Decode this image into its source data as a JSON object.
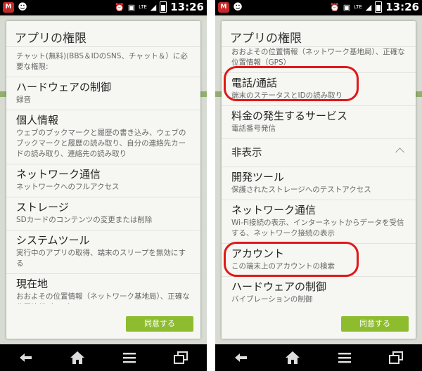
{
  "colors": {
    "accent_green": "#8ebc2f",
    "highlight_red": "#e01818"
  },
  "status_bar": {
    "time": "13:26",
    "network": "LTE"
  },
  "left_screen": {
    "title": "アプリの権限",
    "intro": "チャット(無料)(BBS＆IDのSNS、チャット＆）に必要な権限:",
    "items": [
      {
        "title": "ハードウェアの制御",
        "desc": "録音"
      },
      {
        "title": "個人情報",
        "desc": "ウェブのブックマークと履歴の書き込み、ウェブのブックマークと履歴の読み取り、自分の連絡先カードの読み取り、連絡先の読み取り"
      },
      {
        "title": "ネットワーク通信",
        "desc": "ネットワークへのフルアクセス"
      },
      {
        "title": "ストレージ",
        "desc": "SDカードのコンテンツの変更または削除"
      },
      {
        "title": "システムツール",
        "desc": "実行中のアプリの取得、端末のスリープを無効にする"
      },
      {
        "title": "現在地",
        "desc": "おおよその位置情報（ネットワーク基地局）、正確な位置情報（GPS）"
      }
    ],
    "agree_label": "同意する"
  },
  "right_screen": {
    "title": "アプリの権限",
    "scrolled_text": "おおよその位置情報（ネットワーク基地局）、正確な位置情報（GPS）",
    "items_top": [
      {
        "title": "電話/通話",
        "desc": "端末のステータスとIDの読み取り"
      },
      {
        "title": "料金の発生するサービス",
        "desc": "電話番号発信"
      }
    ],
    "hidden_section": "非表示",
    "items_hidden": [
      {
        "title": "開発ツール",
        "desc": "保護されたストレージへのテストアクセス"
      },
      {
        "title": "ネットワーク通信",
        "desc": "Wi-Fi接続の表示、インターネットからデータを受信する、ネットワーク接続の表示"
      },
      {
        "title": "アカウント",
        "desc": "この端末上のアカウントの検索"
      },
      {
        "title": "ハードウェアの制御",
        "desc": "バイブレーションの制御"
      }
    ],
    "agree_label": "同意する"
  },
  "nav": {
    "icons": [
      "back-icon",
      "home-icon",
      "menu-icon",
      "recent-apps-icon"
    ]
  }
}
